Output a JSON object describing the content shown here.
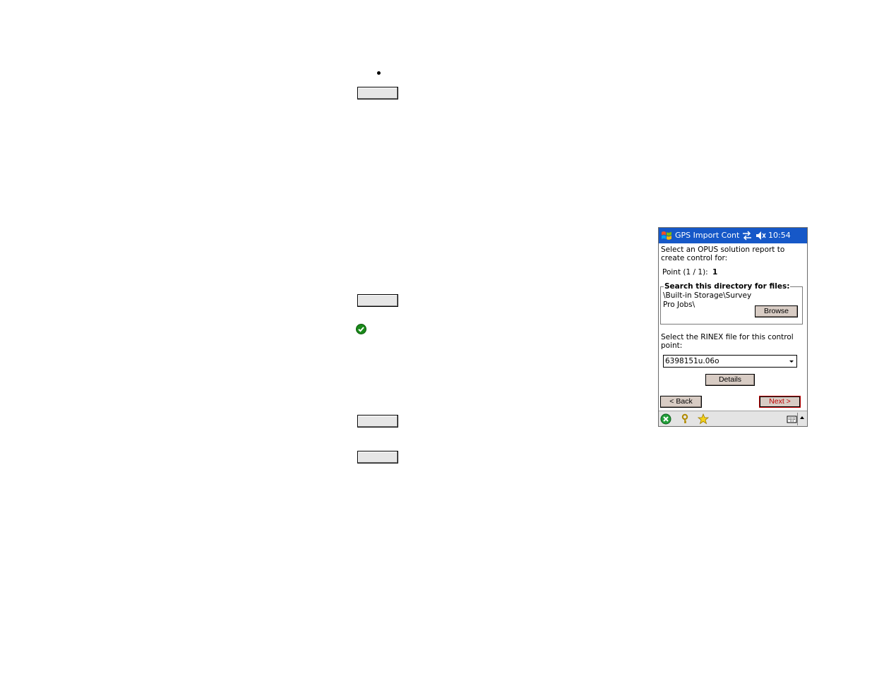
{
  "pda": {
    "title": "GPS Import Contr",
    "clock": "10:54",
    "instruction": [
      "Select an OPUS solution report to",
      "create control for:"
    ],
    "point_label": "Point (1 / 1):",
    "point_value": "1",
    "search_group": {
      "legend": "Search this directory for files:",
      "path_lines": [
        "\\Built-in Storage\\Survey",
        "Pro Jobs\\"
      ],
      "browse_label": "Browse"
    },
    "rinex_prompt": [
      "Select the RINEX file for this control",
      "point:"
    ],
    "rinex_file": "6398151u.06o",
    "details_label": "Details",
    "back_label": "< Back",
    "next_label": "Next >"
  },
  "icons": {
    "start": "windows-start-icon",
    "connectivity": "connectivity-icon",
    "volume": "volume-muted-icon",
    "close": "close-icon",
    "help": "key-help-icon",
    "favorites": "star-icon",
    "keyboard": "keyboard-icon",
    "check": "check-icon"
  },
  "colors": {
    "titlebar": "#1658c8",
    "next_text": "#c00000"
  }
}
